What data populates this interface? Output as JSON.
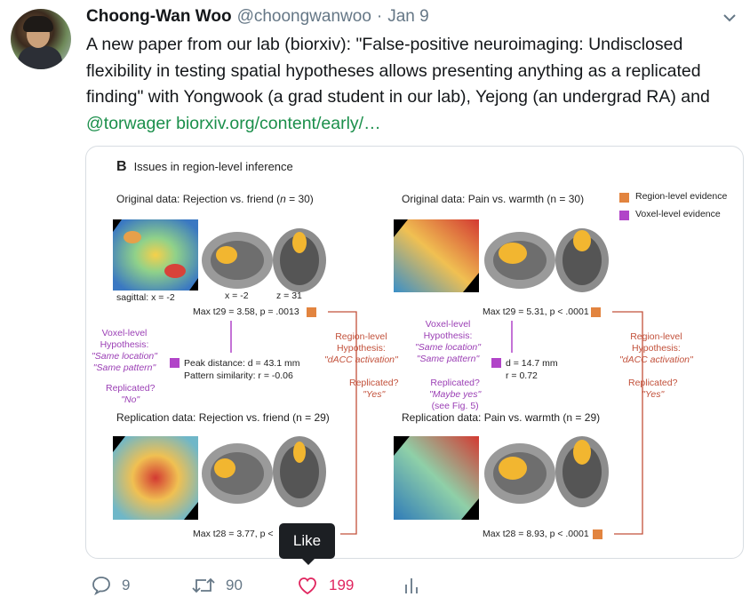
{
  "tweet": {
    "author_name": "Choong-Wan Woo",
    "author_handle": "@choongwanwoo",
    "separator": "·",
    "date": "Jan 9",
    "text_main": "A new paper from our lab (biorxiv): \"False-positive neuroimaging: Undisclosed flexibility in testing spatial hypotheses allows presenting anything as a replicated finding\" with Yongwook (a grad student in our lab), Yejong (an undergrad RA) and ",
    "mention": "@torwager",
    "link": "biorxiv.org/content/early/…"
  },
  "figure": {
    "panel_letter": "B",
    "panel_title": "Issues in region-level inference",
    "legend": {
      "region": "Region-level evidence",
      "voxel": "Voxel-level evidence",
      "region_color": "#e2843f",
      "voxel_color": "#b144c8"
    },
    "left": {
      "original_title_pre": "Original data: Rejection vs. friend (",
      "original_n": "n",
      "original_title_post": " = 30)",
      "sagittal": "sagittal: x = -2",
      "coord_x": "x = -2",
      "coord_z": "z = 31",
      "max_original": "Max t29 = 3.58, p = .0013",
      "voxel_hypothesis": [
        "Voxel-level",
        "Hypothesis:",
        "\"Same location\"",
        "\"Same pattern\""
      ],
      "peak_distance": "Peak distance:  d = 43.1 mm",
      "pattern_similarity": "Pattern similarity:  r = -0.06",
      "replicated_q": "Replicated?",
      "replicated_a": "\"No\"",
      "region_hypothesis": [
        "Region-level",
        "Hypothesis:",
        "\"dACC activation\""
      ],
      "region_replicated_q": "Replicated?",
      "region_replicated_a": "\"Yes\"",
      "replication_title": "Replication data: Rejection vs. friend (n = 29)",
      "max_replication": "Max t28 = 3.77, p <"
    },
    "right": {
      "original_title": "Original data: Pain vs. warmth (n = 30)",
      "max_original": "Max t29 = 5.31, p < .0001",
      "voxel_hypothesis": [
        "Voxel-level",
        "Hypothesis:",
        "\"Same location\"",
        "\"Same pattern\""
      ],
      "distance": "d = 14.7 mm",
      "similarity": "r = 0.72",
      "replicated_q": "Replicated?",
      "replicated_a": "\"Maybe yes\"",
      "see_fig": "(see Fig. 5)",
      "region_hypothesis": [
        "Region-level",
        "Hypothesis:",
        "\"dACC activation\""
      ],
      "region_replicated_q": "Replicated?",
      "region_replicated_a": "\"Yes\"",
      "replication_title": "Replication data: Pain vs. warmth (n = 29)",
      "max_replication": "Max t28 = 8.93, p < .0001"
    }
  },
  "tooltip": "Like",
  "actions": {
    "reply_count": "9",
    "retweet_count": "90",
    "like_count": "199",
    "like_color": "#e0245e",
    "icon_color": "#657786"
  }
}
